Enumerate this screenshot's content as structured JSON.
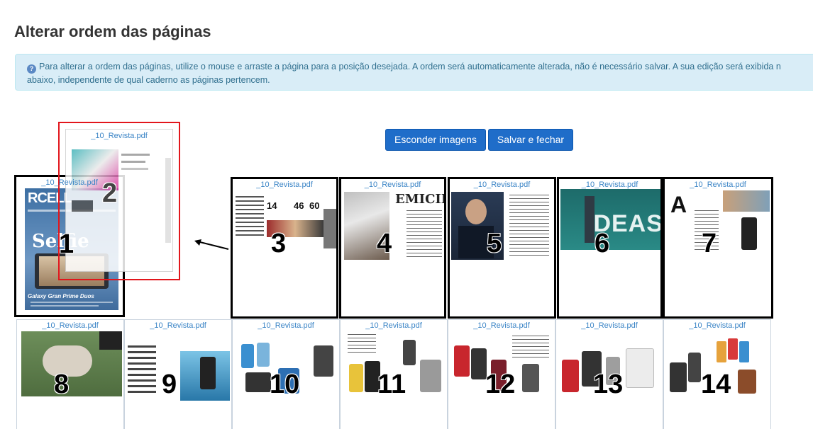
{
  "title": "Alterar ordem das páginas",
  "info": {
    "line1": "Para alterar a ordem das páginas, utilize o mouse e arraste a página para a posição desejada. A ordem será automaticamente alterada, não é necessário salvar. A sua edição será exibida n",
    "line2": "abaixo, independente de qual caderno as páginas pertencem."
  },
  "buttons": {
    "hide": "Esconder imagens",
    "save": "Salvar e fechar"
  },
  "pages": [
    {
      "num": "1",
      "file": "_10_Revista.pdf",
      "cover_lines": [
        "RCELL",
        "Selfie",
        "Galaxy Gran Prime Duos"
      ]
    },
    {
      "num": "2",
      "file": "_10_Revista.pdf"
    },
    {
      "num": "3",
      "file": "_10_Revista.pdf"
    },
    {
      "num": "4",
      "file": "_10_Revista.pdf"
    },
    {
      "num": "5",
      "file": "_10_Revista.pdf"
    },
    {
      "num": "6",
      "file": "_10_Revista.pdf"
    },
    {
      "num": "7",
      "file": "_10_Revista.pdf"
    },
    {
      "num": "8",
      "file": "_10_Revista.pdf"
    },
    {
      "num": "9",
      "file": "_10_Revista.pdf"
    },
    {
      "num": "10",
      "file": "_10_Revista.pdf"
    },
    {
      "num": "11",
      "file": "_10_Revista.pdf"
    },
    {
      "num": "12",
      "file": "_10_Revista.pdf"
    },
    {
      "num": "13",
      "file": "_10_Revista.pdf"
    },
    {
      "num": "14",
      "file": "_10_Revista.pdf"
    }
  ],
  "colors": {
    "info_bg": "#d9edf7",
    "info_text": "#31708f",
    "button": "#1f6dc9",
    "link": "#3a84c6",
    "drag_border": "#e2161c"
  }
}
